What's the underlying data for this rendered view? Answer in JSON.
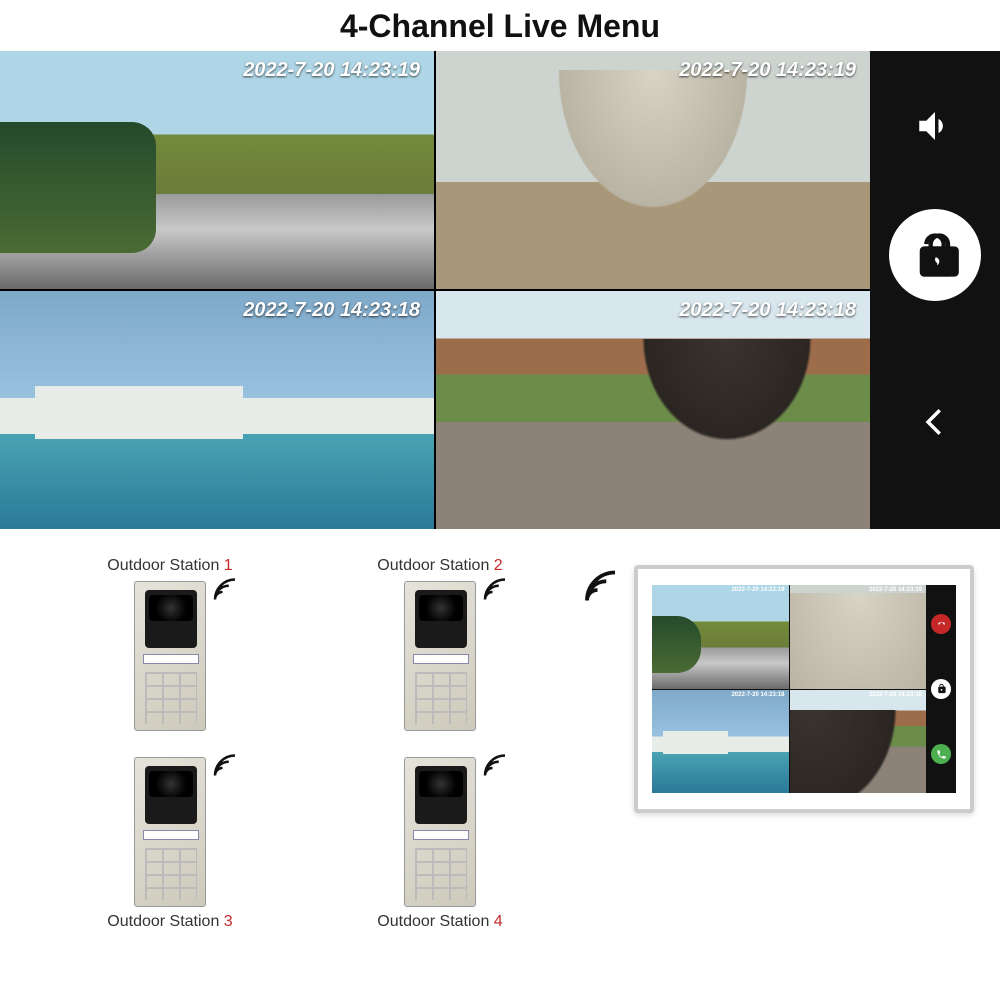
{
  "title": "4-Channel Live Menu",
  "cameras": [
    {
      "ts_date": "2022-7-20",
      "ts_time": "14:23:19"
    },
    {
      "ts_date": "2022-7-20",
      "ts_time": "14:23:19"
    },
    {
      "ts_date": "2022-7-20",
      "ts_time": "14:23:18"
    },
    {
      "ts_date": "2022-7-20",
      "ts_time": "14:23:18"
    }
  ],
  "stations": [
    {
      "label": "Outdoor Station ",
      "n": "1"
    },
    {
      "label": "Outdoor Station ",
      "n": "2"
    },
    {
      "label": "Outdoor Station ",
      "n": "3"
    },
    {
      "label": "Outdoor Station ",
      "n": "4"
    }
  ],
  "mini_ts": [
    "2022-7-20 14:23:19",
    "2022-7-20 14:23:19",
    "2022-7-20 14:23:18",
    "2022-7-20 14:23:18"
  ]
}
